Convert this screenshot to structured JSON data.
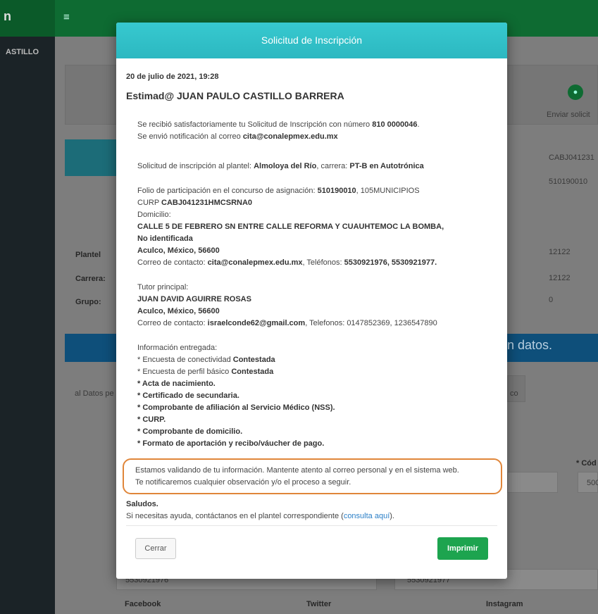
{
  "app": {
    "brand": "n",
    "user": "ASTILLO",
    "step_label": "Enviar solicit",
    "side_values": [
      "CABJ041231",
      "510190010",
      "12122",
      "12122",
      "0"
    ],
    "labels": [
      "Plantel",
      "Carrera:",
      "Grupo:"
    ],
    "banner_text": "n datos.",
    "tab_text": "al Datos pe",
    "tab2_text": "co",
    "required_label": "* Cód",
    "field_value": "500",
    "phones": [
      "5530921976",
      "5530921977"
    ],
    "social": [
      "Facebook",
      "Twitter",
      "Instagram"
    ]
  },
  "modal": {
    "title": "Solicitud de Inscripción",
    "date": "20 de julio de 2021, 19:28",
    "greeting": "Estimad@ JUAN PAULO CASTILLO BARRERA",
    "received_prefix": "Se recibió satisfactoriamente tu Solicitud de Inscripción con número ",
    "request_number": "810 0000046",
    "received_suffix": ".",
    "notify_prefix": "Se envió notificación al correo ",
    "notify_email": "cita@conalepmex.edu.mx",
    "school_prefix": "Solicitud de inscripción al plantel: ",
    "school": "Almoloya del Río",
    "career_prefix": ", carrera: ",
    "career": "PT-B en Autotrónica",
    "folio_prefix": "Folio de participación en el concurso de asignación: ",
    "folio": "510190010",
    "folio_suffix": ", 105MUNICIPIOS",
    "curp_prefix": "CURP ",
    "curp": "CABJ041231HMCSRNA0",
    "address_label": "Domicilio:",
    "address_line1": "CALLE 5 DE FEBRERO SN ENTRE CALLE REFORMA Y CUAUHTEMOC LA BOMBA,",
    "address_line2": "No identificada",
    "address_line3": "Aculco, México, 56600",
    "contact_prefix": "Correo de contacto: ",
    "contact_email": "cita@conalepmex.edu.mx",
    "phones_prefix": ", Teléfonos: ",
    "phones": "5530921976, 5530921977.",
    "tutor_label": "Tutor principal:",
    "tutor_name": "JUAN DAVID AGUIRRE ROSAS",
    "tutor_address": "Aculco, México, 56600",
    "tutor_contact_prefix": "Correo de contacto: ",
    "tutor_email": "israelconde62@gmail.com",
    "tutor_phones_prefix": ", Telefonos: ",
    "tutor_phones": "0147852369, 1236547890",
    "info_label": "Información entregada:",
    "survey1_prefix": "* Encuesta de conectividad ",
    "survey1_status": "Contestada",
    "survey2_prefix": "* Encuesta de perfil básico ",
    "survey2_status": "Contestada",
    "docs": [
      "* Acta de nacimiento.",
      "* Certificado de secundaria.",
      "* Comprobante de afiliación al Servicio Médico (NSS).",
      "* CURP.",
      "* Comprobante de domicilio.",
      "* Formato de aportación y recibo/váucher de pago."
    ],
    "alert_line1": "Estamos validando de tu información. Mantente atento al correo personal y en el sistema web.",
    "alert_line2": "Te notificaremos cualquier observación y/o el proceso a seguir.",
    "saludos": "Saludos.",
    "help_prefix": "Si necesitas ayuda, contáctanos en el plantel correspondiente (",
    "help_link": "consulta aquí",
    "help_suffix": ").",
    "close_label": "Cerrar",
    "print_label": "Imprimir"
  },
  "colors": {
    "header": "#2cb8c1",
    "print_button": "#1da44f",
    "alert_border": "#e0863a",
    "topbar": "#0e6b32"
  }
}
